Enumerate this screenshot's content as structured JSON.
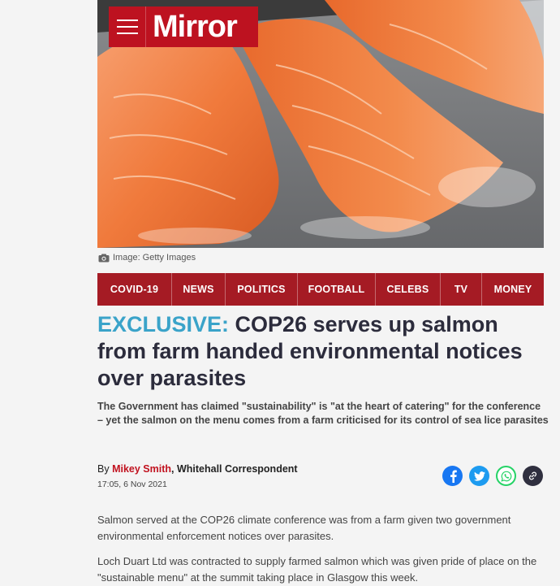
{
  "masthead": {
    "brand": "Mirror",
    "menu_icon": "hamburger-icon"
  },
  "hero": {
    "caption": "Image: Getty Images",
    "camera_icon": "camera-icon"
  },
  "nav": {
    "items": [
      "COVID-19",
      "NEWS",
      "POLITICS",
      "FOOTBALL",
      "CELEBS",
      "TV",
      "MONEY"
    ]
  },
  "article": {
    "headline_prefix": "EXCLUSIVE:",
    "headline": "COP26 serves up salmon from farm handed environmental notices over parasites",
    "standfirst": "The Government has claimed \"sustainability\" is \"at the heart of catering\" for the conference – yet the salmon on the menu comes from a farm criticised for its control of sea lice parasites",
    "byline_prefix": "By",
    "author": "Mikey Smith",
    "role": ", Whitehall Correspondent",
    "timestamp": "17:05, 6 Nov 2021",
    "paragraphs": [
      "Salmon served at the COP26 climate conference was from a farm given two government environmental enforcement notices over parasites.",
      "Loch Duart Ltd was contracted to supply farmed salmon which was given pride of place on the \"sustainable menu\" at the summit taking place in Glasgow this week."
    ]
  },
  "share": {
    "facebook_color": "#1877f2",
    "twitter_color": "#1d9bf0",
    "whatsapp_color": "#25d366",
    "link_color": "#2f2f3f"
  }
}
